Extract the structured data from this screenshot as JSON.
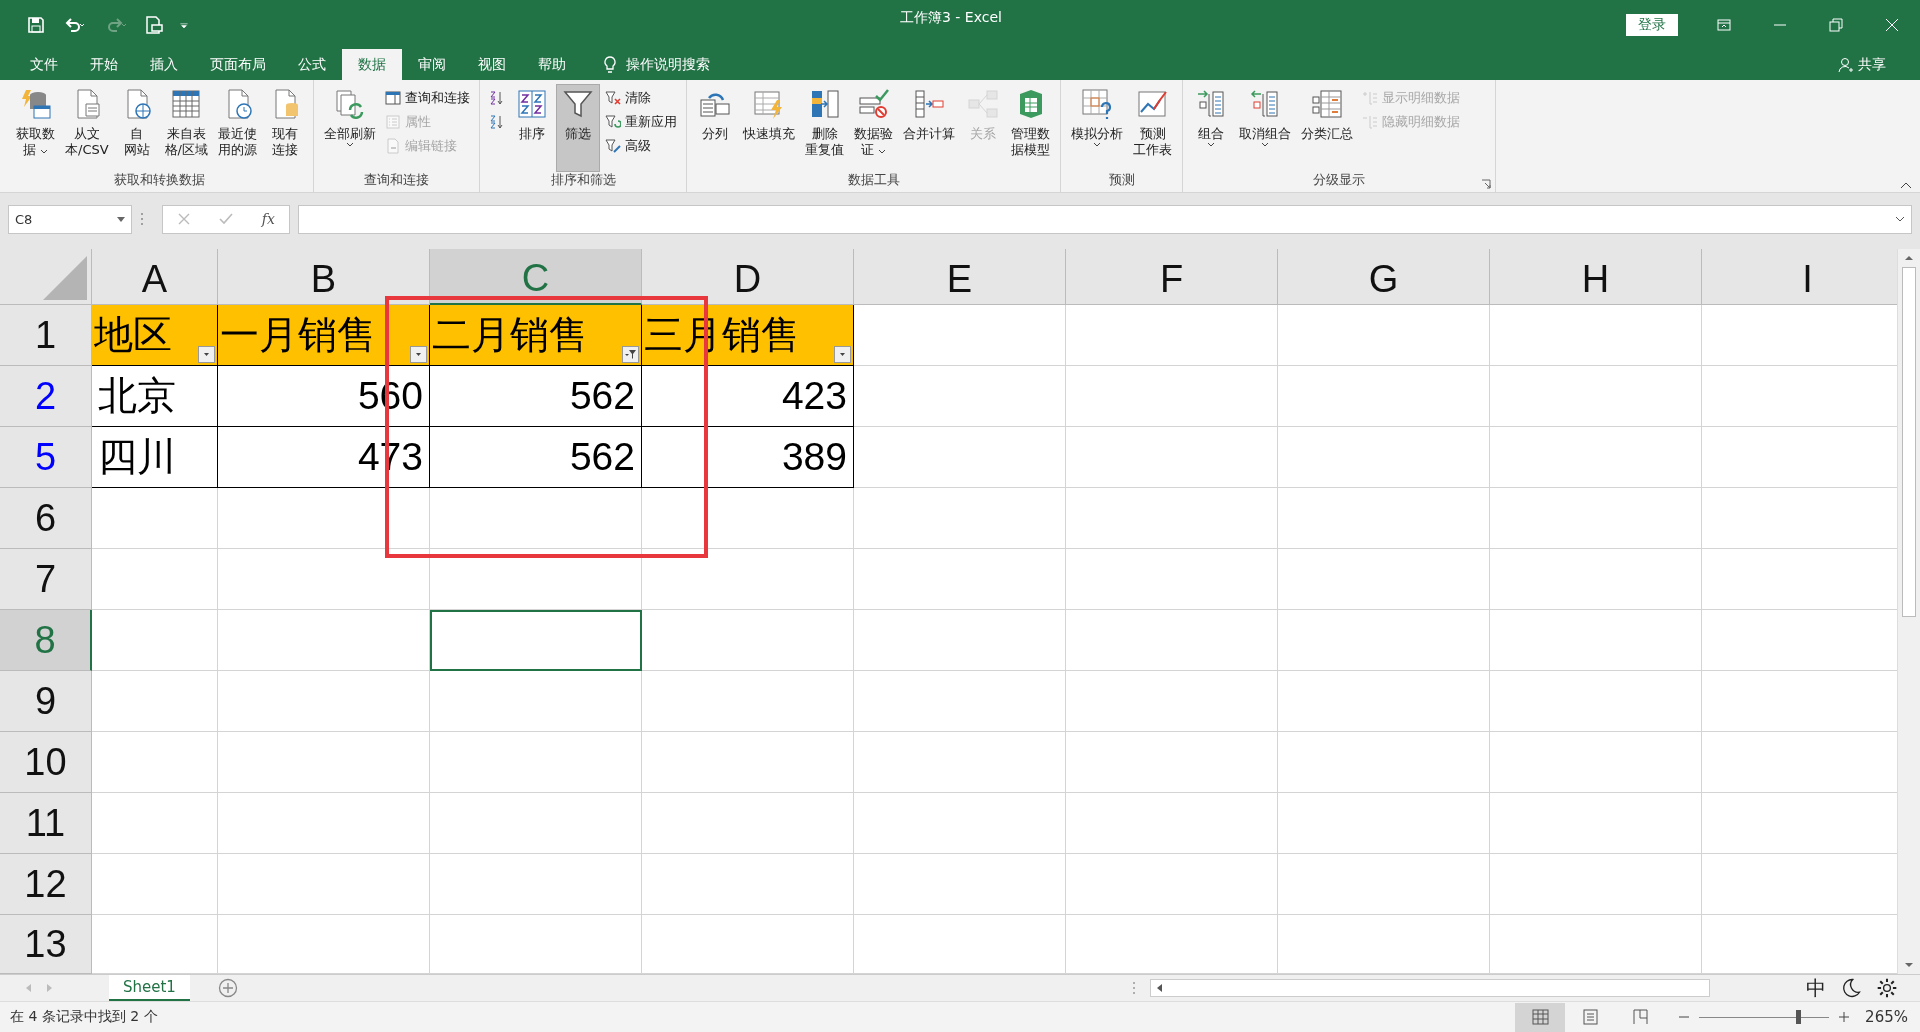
{
  "title_bar": {
    "title": "工作簿3  -  Excel",
    "login": "登录"
  },
  "tabs": [
    {
      "label": "文件",
      "selected": false
    },
    {
      "label": "开始",
      "selected": false
    },
    {
      "label": "插入",
      "selected": false
    },
    {
      "label": "页面布局",
      "selected": false
    },
    {
      "label": "公式",
      "selected": false
    },
    {
      "label": "数据",
      "selected": true
    },
    {
      "label": "审阅",
      "selected": false
    },
    {
      "label": "视图",
      "selected": false
    },
    {
      "label": "帮助",
      "selected": false
    }
  ],
  "tell_me": "操作说明搜索",
  "share": "共享",
  "ribbon_groups": [
    {
      "label": "获取和转换数据",
      "items": [
        {
          "kind": "large",
          "lines": [
            "获取数",
            "据"
          ],
          "dropdown": true,
          "disabled": false,
          "pressed": false
        },
        {
          "kind": "large",
          "lines": [
            "从文",
            "本/CSV"
          ],
          "dropdown": false,
          "disabled": false,
          "pressed": false
        },
        {
          "kind": "large",
          "lines": [
            "自",
            "网站"
          ],
          "dropdown": false,
          "disabled": false,
          "pressed": false
        },
        {
          "kind": "large",
          "lines": [
            "来自表",
            "格/区域"
          ],
          "dropdown": false,
          "disabled": false,
          "pressed": false
        },
        {
          "kind": "large",
          "lines": [
            "最近使",
            "用的源"
          ],
          "dropdown": false,
          "disabled": false,
          "pressed": false
        },
        {
          "kind": "large",
          "lines": [
            "现有",
            "连接"
          ],
          "dropdown": false,
          "disabled": false,
          "pressed": false
        }
      ]
    },
    {
      "label": "查询和连接",
      "items": [
        {
          "kind": "large",
          "lines": [
            "全部刷新"
          ],
          "dropdown": true,
          "disabled": false,
          "pressed": false
        },
        {
          "kind": "small",
          "lines": [
            "查询和连接"
          ],
          "dropdown": false,
          "disabled": false,
          "pressed": false
        },
        {
          "kind": "small",
          "lines": [
            "属性"
          ],
          "dropdown": false,
          "disabled": true,
          "pressed": false
        },
        {
          "kind": "small",
          "lines": [
            "编辑链接"
          ],
          "dropdown": false,
          "disabled": true,
          "pressed": false
        }
      ]
    },
    {
      "label": "排序和筛选",
      "items": [
        {
          "kind": "small",
          "dropdown": false,
          "disabled": false,
          "pressed": false
        },
        {
          "kind": "small",
          "dropdown": false,
          "disabled": false,
          "pressed": false
        },
        {
          "kind": "large",
          "lines": [
            "排序"
          ],
          "dropdown": false,
          "disabled": false,
          "pressed": false
        },
        {
          "kind": "large",
          "lines": [
            "筛选"
          ],
          "dropdown": false,
          "disabled": false,
          "pressed": true
        },
        {
          "kind": "small",
          "lines": [
            "清除"
          ],
          "dropdown": false,
          "disabled": false,
          "pressed": false
        },
        {
          "kind": "small",
          "lines": [
            "重新应用"
          ],
          "dropdown": false,
          "disabled": false,
          "pressed": false
        },
        {
          "kind": "small",
          "lines": [
            "高级"
          ],
          "dropdown": false,
          "disabled": false,
          "pressed": false
        }
      ]
    },
    {
      "label": "数据工具",
      "items": [
        {
          "kind": "large",
          "lines": [
            "分列"
          ],
          "dropdown": false,
          "disabled": false,
          "pressed": false
        },
        {
          "kind": "large",
          "lines": [
            "快速填充"
          ],
          "dropdown": false,
          "disabled": false,
          "pressed": false
        },
        {
          "kind": "large",
          "lines": [
            "删除",
            "重复值"
          ],
          "dropdown": false,
          "disabled": false,
          "pressed": false
        },
        {
          "kind": "large",
          "lines": [
            "数据验",
            "证"
          ],
          "dropdown": true,
          "disabled": false,
          "pressed": false
        },
        {
          "kind": "large",
          "lines": [
            "合并计算"
          ],
          "dropdown": false,
          "disabled": false,
          "pressed": false
        },
        {
          "kind": "large",
          "lines": [
            "关系"
          ],
          "dropdown": false,
          "disabled": true,
          "pressed": false
        },
        {
          "kind": "large",
          "lines": [
            "管理数",
            "据模型"
          ],
          "dropdown": false,
          "disabled": false,
          "pressed": false
        }
      ]
    },
    {
      "label": "预测",
      "items": [
        {
          "kind": "large",
          "lines": [
            "模拟分析"
          ],
          "dropdown": true,
          "disabled": false,
          "pressed": false
        },
        {
          "kind": "large",
          "lines": [
            "预测",
            "工作表"
          ],
          "dropdown": false,
          "disabled": false,
          "pressed": false
        }
      ]
    },
    {
      "label": "分级显示",
      "items": [
        {
          "kind": "large",
          "lines": [
            "组合"
          ],
          "dropdown": true,
          "disabled": false,
          "pressed": false
        },
        {
          "kind": "large",
          "lines": [
            "取消组合"
          ],
          "dropdown": true,
          "disabled": false,
          "pressed": false
        },
        {
          "kind": "large",
          "lines": [
            "分类汇总"
          ],
          "dropdown": false,
          "disabled": false,
          "pressed": false
        },
        {
          "kind": "small",
          "lines": [
            "显示明细数据"
          ],
          "dropdown": false,
          "disabled": true,
          "pressed": false
        },
        {
          "kind": "small",
          "lines": [
            "隐藏明细数据"
          ],
          "dropdown": false,
          "disabled": true,
          "pressed": false
        }
      ]
    }
  ],
  "formula_bar": {
    "name_box": "C8",
    "function_label": "fx"
  },
  "columns": [
    {
      "label": "A",
      "selected": false
    },
    {
      "label": "B",
      "selected": false
    },
    {
      "label": "C",
      "selected": true
    },
    {
      "label": "D",
      "selected": false
    },
    {
      "label": "E",
      "selected": false
    },
    {
      "label": "F",
      "selected": false
    },
    {
      "label": "G",
      "selected": false
    },
    {
      "label": "H",
      "selected": false
    },
    {
      "label": "I",
      "selected": false
    }
  ],
  "rows": [
    {
      "label": "1",
      "selected": false,
      "filtered": false,
      "cells": [
        {
          "text": "地区",
          "kind": "header",
          "filter_applied": false
        },
        {
          "text": "一月销售",
          "kind": "header",
          "filter_applied": false
        },
        {
          "text": "二月销售",
          "kind": "header",
          "filter_applied": true
        },
        {
          "text": "三月销售",
          "kind": "header",
          "filter_applied": false
        }
      ]
    },
    {
      "label": "2",
      "selected": false,
      "filtered": true,
      "cells": [
        {
          "text": "北京",
          "kind": "text"
        },
        {
          "text": "560",
          "kind": "number"
        },
        {
          "text": "562",
          "kind": "number"
        },
        {
          "text": "423",
          "kind": "number"
        }
      ]
    },
    {
      "label": "5",
      "selected": false,
      "filtered": true,
      "cells": [
        {
          "text": "四川",
          "kind": "text"
        },
        {
          "text": "473",
          "kind": "number"
        },
        {
          "text": "562",
          "kind": "number"
        },
        {
          "text": "389",
          "kind": "number"
        }
      ]
    },
    {
      "label": "6",
      "selected": false,
      "filtered": false,
      "cells": []
    },
    {
      "label": "7",
      "selected": false,
      "filtered": false,
      "cells": []
    },
    {
      "label": "8",
      "selected": true,
      "filtered": false,
      "cells": []
    },
    {
      "label": "9",
      "selected": false,
      "filtered": false,
      "cells": []
    },
    {
      "label": "10",
      "selected": false,
      "filtered": false,
      "cells": []
    },
    {
      "label": "11",
      "selected": false,
      "filtered": false,
      "cells": []
    },
    {
      "label": "12",
      "selected": false,
      "filtered": false,
      "cells": []
    },
    {
      "label": "13",
      "selected": false,
      "filtered": false,
      "cells": []
    }
  ],
  "annotations": [
    {
      "kind": "rectangle"
    }
  ],
  "sheet_tabs": [
    {
      "label": "Sheet1",
      "selected": true
    }
  ],
  "ime_bar": {
    "label": "中"
  },
  "status_bar": {
    "message": "在 4 条记录中找到 2 个",
    "views": [
      {
        "selected": true
      },
      {
        "selected": false
      },
      {
        "selected": false
      }
    ],
    "zoom": {
      "level": 0.76,
      "reading": "265%"
    }
  }
}
